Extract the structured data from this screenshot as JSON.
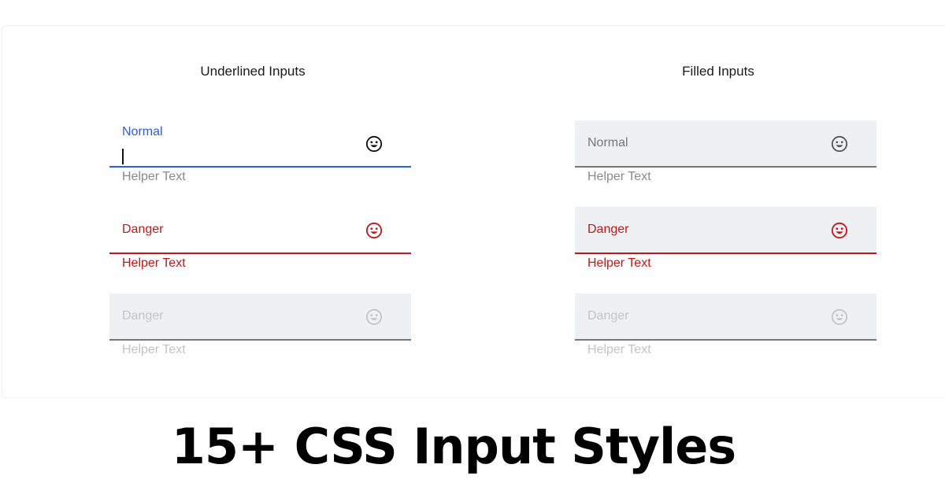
{
  "colors": {
    "primary": "#2f5fd6",
    "danger": "#c01818",
    "muted": "#808080",
    "disabled": "#c4c4c4",
    "line_default": "#777777",
    "fill": "#eff0f2"
  },
  "underlined": {
    "title": "Underlined Inputs",
    "fields": [
      {
        "label": "Normal",
        "helper": "Helper Text",
        "state": "focused",
        "icon": "smiley-icon"
      },
      {
        "label": "Danger",
        "helper": "Helper Text",
        "state": "danger",
        "icon": "smiley-icon"
      },
      {
        "label": "Danger",
        "helper": "Helper Text",
        "state": "disabled",
        "icon": "smiley-icon"
      }
    ]
  },
  "filled": {
    "title": "Filled Inputs",
    "fields": [
      {
        "label": "Normal",
        "helper": "Helper Text",
        "state": "normal",
        "icon": "smiley-icon"
      },
      {
        "label": "Danger",
        "helper": "Helper Text",
        "state": "danger",
        "icon": "smiley-icon"
      },
      {
        "label": "Danger",
        "helper": "Helper Text",
        "state": "disabled",
        "icon": "smiley-icon"
      }
    ]
  },
  "banner": {
    "title": "15+ CSS Input Styles"
  }
}
